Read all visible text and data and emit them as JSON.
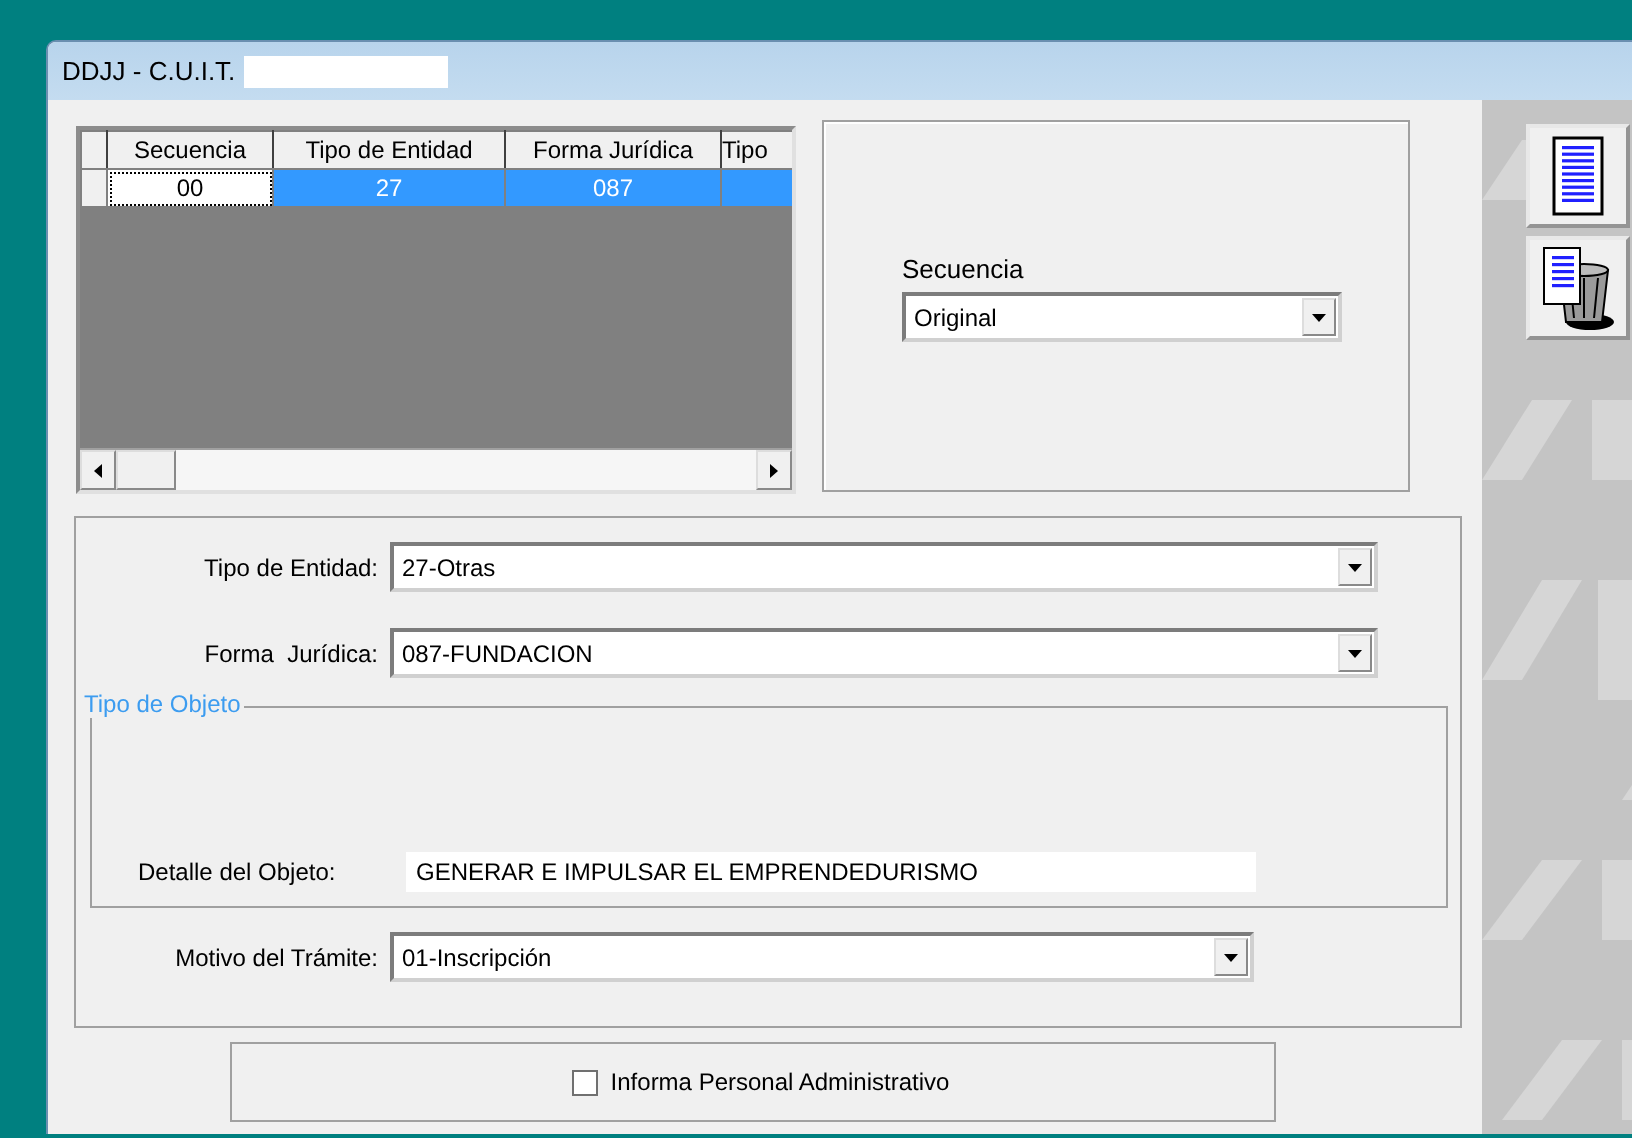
{
  "window": {
    "title": "DDJJ - C.U.I.T."
  },
  "grid": {
    "columns": [
      "Secuencia",
      "Tipo de Entidad",
      "Forma Jurídica",
      "Tipo"
    ],
    "rows": [
      {
        "cells": [
          "00",
          "27",
          "087"
        ],
        "selected": true
      }
    ]
  },
  "sequence": {
    "label": "Secuencia",
    "value": "Original"
  },
  "toolbar": [
    {
      "kind": "document"
    },
    {
      "kind": "delete"
    }
  ],
  "fields": [
    {
      "label": "Tipo de Entidad:",
      "value": "27-Otras"
    },
    {
      "label": "Forma  Jurídica:",
      "value": "087-FUNDACION"
    }
  ],
  "object_group": {
    "legend": "Tipo de Objeto",
    "detail_label": "Detalle del Objeto:",
    "detail_value": "GENERAR E IMPULSAR EL EMPRENDEDURISMO"
  },
  "reason": {
    "label": "Motivo del Trámite:",
    "value": "01-Inscripción"
  },
  "admin_staff": {
    "label": "Informa Personal Administrativo",
    "checked": false
  }
}
